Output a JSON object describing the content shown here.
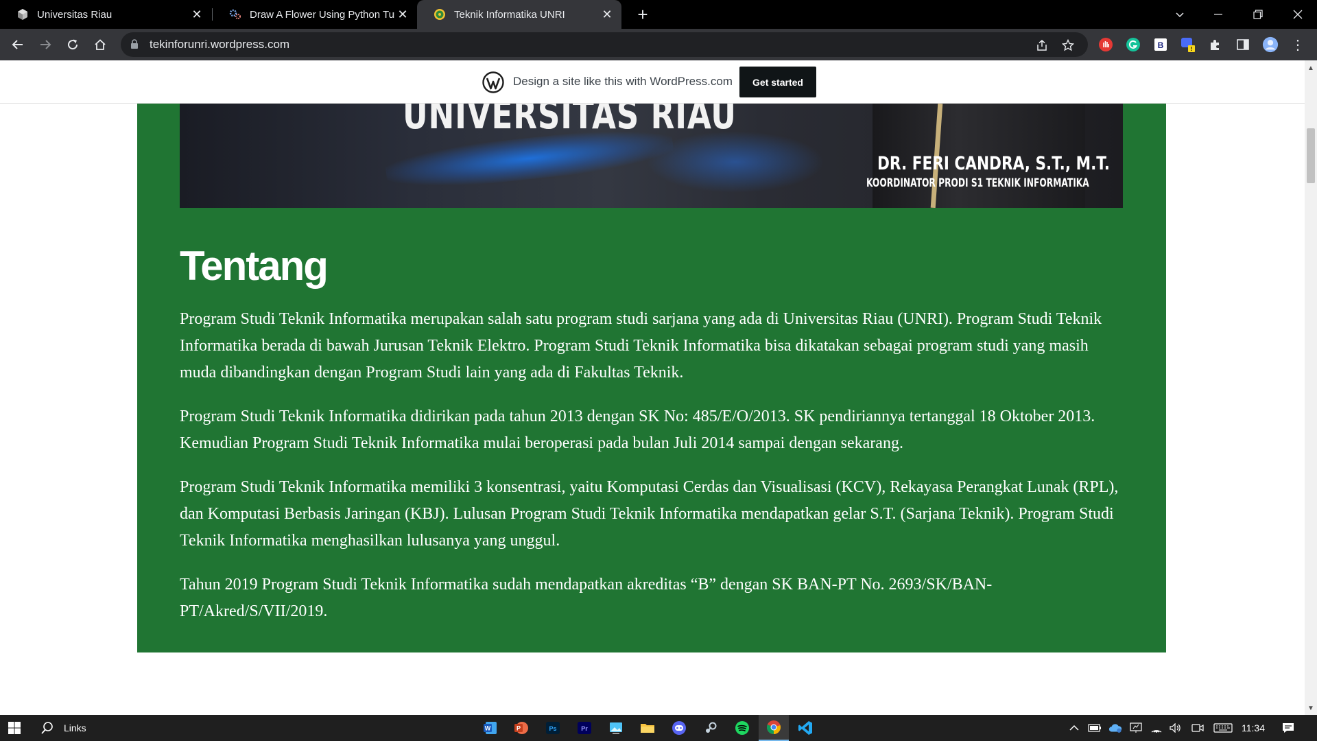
{
  "browser": {
    "tabs": [
      {
        "title": "Universitas Riau",
        "active": false
      },
      {
        "title": "Draw A Flower Using Python Turt",
        "active": false
      },
      {
        "title": "Teknik Informatika UNRI",
        "active": true
      }
    ],
    "new_tab_label": "+",
    "url": "tekinforunri.wordpress.com"
  },
  "wp_banner": {
    "text": "Design a site like this with WordPress.com",
    "button": "Get started"
  },
  "hero": {
    "headline": "UNIVERSITAS RIAU",
    "name": "DR. FERI CANDRA, S.T., M.T.",
    "role": "KOORDINATOR PRODI S1 TEKNIK INFORMATIKA"
  },
  "content": {
    "heading": "Tentang",
    "paragraphs": [
      "Program Studi Teknik Informatika merupakan salah satu program studi sarjana yang ada di Universitas Riau (UNRI). Program Studi Teknik Informatika berada di bawah Jurusan Teknik Elektro. Program Studi Teknik Informatika bisa dikatakan sebagai program studi yang masih muda dibandingkan dengan Program Studi lain yang ada di Fakultas Teknik.",
      "Program Studi Teknik Informatika didirikan pada tahun 2013 dengan SK No: 485/E/O/2013. SK pendiriannya tertanggal 18 Oktober 2013. Kemudian Program Studi Teknik Informatika mulai beroperasi pada bulan Juli 2014 sampai dengan sekarang.",
      "Program Studi Teknik Informatika memiliki 3 konsentrasi, yaitu Komputasi Cerdas dan Visualisasi (KCV), Rekayasa Perangkat Lunak (RPL), dan Komputasi Berbasis Jaringan (KBJ). Lulusan Program Studi Teknik Informatika mendapatkan gelar S.T. (Sarjana Teknik). Program Studi Teknik Informatika menghasilkan lulusanya yang unggul.",
      "Tahun 2019 Program Studi Teknik Informatika sudah mendapatkan akreditas “B” dengan SK BAN-PT No. 2693/SK/BAN-PT/Akred/S/VII/2019."
    ]
  },
  "taskbar": {
    "search_label": "Links",
    "clock": "11:34"
  },
  "colors": {
    "content_green": "#207533",
    "tabstrip": "#000000",
    "toolbar": "#35363a",
    "taskbar": "#1f1f1f"
  }
}
